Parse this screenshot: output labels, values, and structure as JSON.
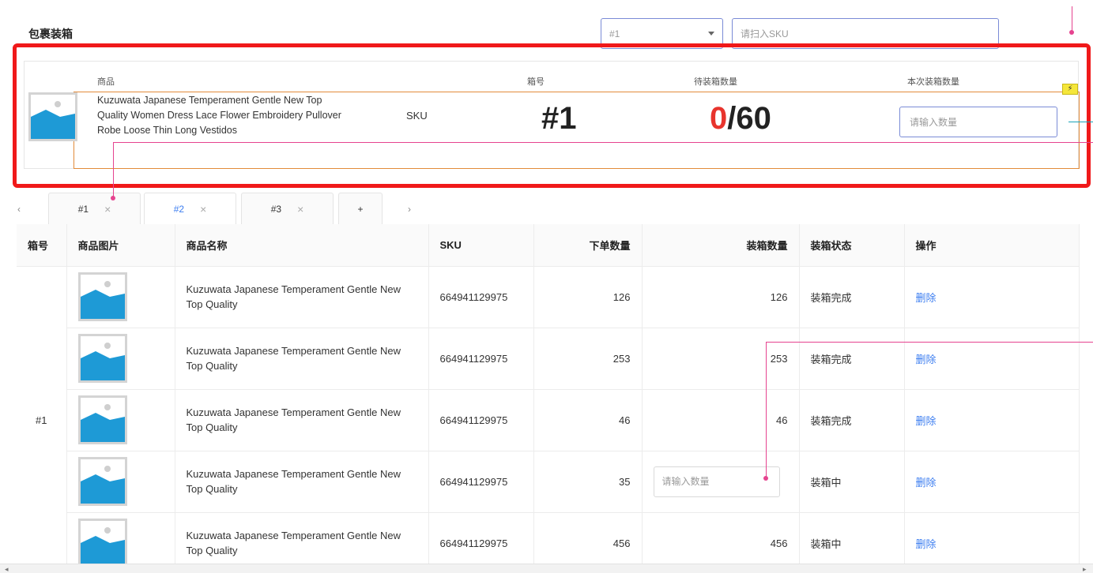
{
  "header": {
    "title": "包裹装箱",
    "box_select_value": "#1",
    "sku_placeholder": "请扫入SKU"
  },
  "scan_panel": {
    "headers": {
      "product": "商品",
      "box_no": "箱号",
      "pending_qty": "待装箱数量",
      "this_qty": "本次装箱数量"
    },
    "product_name": "Kuzuwata Japanese Temperament Gentle New Top Quality Women Dress Lace Flower Embroidery Pullover Robe Loose Thin Long Vestidos",
    "sku_label": "SKU",
    "box_no": "#1",
    "pending_done": "0",
    "pending_total": "/60",
    "qty_placeholder": "请输入数量"
  },
  "tabs": {
    "prev_icon": "‹",
    "next_icon": "›",
    "items": [
      {
        "label": "#1",
        "close": "×"
      },
      {
        "label": "#2",
        "close": "×"
      },
      {
        "label": "#3",
        "close": "×"
      }
    ],
    "add_label": "+"
  },
  "table": {
    "columns": [
      "箱号",
      "商品图片",
      "商品名称",
      "SKU",
      "下单数量",
      "装箱数量",
      "装箱状态",
      "操作"
    ],
    "box_label": "#1",
    "input_placeholder": "请输入数量",
    "rows": [
      {
        "name": "Kuzuwata Japanese Temperament Gentle New Top Quality",
        "sku": "664941129975",
        "ordered": "126",
        "packed": "126",
        "status": "装箱完成",
        "action": "删除"
      },
      {
        "name": "Kuzuwata Japanese Temperament Gentle New Top Quality",
        "sku": "664941129975",
        "ordered": "253",
        "packed": "253",
        "status": "装箱完成",
        "action": "删除"
      },
      {
        "name": "Kuzuwata Japanese Temperament Gentle New Top Quality",
        "sku": "664941129975",
        "ordered": "46",
        "packed": "46",
        "status": "装箱完成",
        "action": "删除"
      },
      {
        "name": "Kuzuwata Japanese Temperament Gentle New Top Quality",
        "sku": "664941129975",
        "ordered": "35",
        "packed": "",
        "status": "装箱中",
        "action": "删除"
      },
      {
        "name": "Kuzuwata Japanese Temperament Gentle New Top Quality",
        "sku": "664941129975",
        "ordered": "456",
        "packed": "456",
        "status": "装箱中",
        "action": "删除"
      }
    ]
  },
  "colors": {
    "highlight_frame": "#f0191a",
    "selection_frame": "#e28b3a",
    "link": "#3d7ef0",
    "pending_done": "#e8342d",
    "annotation": "#e6438f"
  },
  "scrollbar": {
    "left_icon": "◂",
    "right_icon": "▸"
  }
}
